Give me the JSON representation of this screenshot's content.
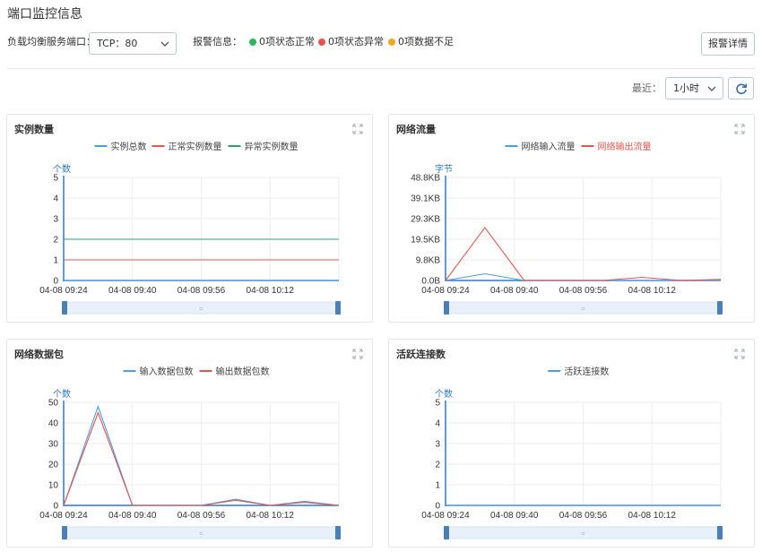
{
  "page_title": "端口监控信息",
  "filter": {
    "port_label": "负载均衡服务端口：",
    "port_value": "TCP：80",
    "alarm_label": "报警信息：",
    "statuses": [
      {
        "text": "0项状态正常",
        "color": "#2db55d"
      },
      {
        "text": "0项状态异常",
        "color": "#e8554e"
      },
      {
        "text": "0项数据不足",
        "color": "#f5a623"
      }
    ],
    "alarm_detail_button": "报警详情"
  },
  "range": {
    "label": "最近：",
    "value": "1小时"
  },
  "panels": [
    {
      "title": "实例数量"
    },
    {
      "title": "网络流量"
    },
    {
      "title": "网络数据包"
    },
    {
      "title": "活跃连接数"
    }
  ],
  "chart_data": [
    {
      "type": "line",
      "title": "实例数量",
      "ylabel": "个数",
      "yticks": [
        "0",
        "1",
        "2",
        "3",
        "4",
        "5"
      ],
      "ylim": [
        0,
        5
      ],
      "x": [
        "04-08 09:24",
        "04-08 09:40",
        "04-08 09:56",
        "04-08 10:12"
      ],
      "legend_position": "top-center",
      "grid": true,
      "series": [
        {
          "name": "实例总数",
          "color": "#4a9fe3",
          "values": [
            0,
            0,
            0,
            0,
            0
          ]
        },
        {
          "name": "正常实例数量",
          "color": "#e8554e",
          "values": [
            1,
            1,
            1,
            1,
            1
          ]
        },
        {
          "name": "异常实例数量",
          "color": "#2aa36b",
          "values": [
            2,
            2,
            2,
            2,
            2
          ]
        }
      ]
    },
    {
      "type": "line",
      "title": "网络流量",
      "ylabel": "字节",
      "yticks": [
        "0.0B",
        "9.8KB",
        "19.5KB",
        "29.3KB",
        "39.1KB",
        "48.8KB"
      ],
      "ylim": [
        0,
        48.8
      ],
      "x": [
        "04-08 09:24",
        "04-08 09:40",
        "04-08 09:56",
        "04-08 10:12"
      ],
      "legend_position": "top-center",
      "grid": true,
      "series": [
        {
          "name": "网络输入流量",
          "color": "#4a9fe3",
          "values": [
            0,
            3.2,
            0,
            0,
            0,
            0,
            0,
            0
          ]
        },
        {
          "name": "网络输出流量",
          "color": "#e8554e",
          "values": [
            0,
            25,
            0,
            0,
            0,
            1.5,
            0,
            0.5
          ]
        }
      ]
    },
    {
      "type": "line",
      "title": "网络数据包",
      "ylabel": "个数",
      "yticks": [
        "0",
        "10",
        "20",
        "30",
        "40",
        "50"
      ],
      "ylim": [
        0,
        50
      ],
      "x": [
        "04-08 09:24",
        "04-08 09:40",
        "04-08 09:56",
        "04-08 10:12"
      ],
      "legend_position": "top-center",
      "grid": true,
      "series": [
        {
          "name": "输入数据包数",
          "color": "#4a9fe3",
          "values": [
            0,
            48,
            0,
            0,
            0,
            3,
            0,
            2,
            0
          ]
        },
        {
          "name": "输出数据包数",
          "color": "#e8554e",
          "values": [
            0,
            45,
            0,
            0,
            0,
            2.5,
            0,
            1.5,
            0
          ]
        }
      ]
    },
    {
      "type": "line",
      "title": "活跃连接数",
      "ylabel": "个数",
      "yticks": [
        "0",
        "1",
        "2",
        "3",
        "4",
        "5"
      ],
      "ylim": [
        0,
        5
      ],
      "x": [
        "04-08 09:24",
        "04-08 09:40",
        "04-08 09:56",
        "04-08 10:12"
      ],
      "legend_position": "top-center",
      "grid": true,
      "series": [
        {
          "name": "活跃连接数",
          "color": "#4a9fe3",
          "values": [
            0,
            0,
            0,
            0,
            0
          ]
        }
      ]
    }
  ]
}
